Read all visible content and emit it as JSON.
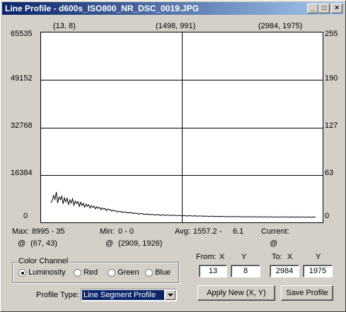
{
  "window": {
    "title": "Line Profile - d600s_ISO800_NR_DSC_0019.JPG",
    "buttons": [
      "_",
      "□",
      "×"
    ]
  },
  "chart": {
    "top_labels": [
      "(13, 8)",
      "(1498, 991)",
      "(2984, 1975)"
    ],
    "left_ticks": [
      "65535",
      "49152",
      "32768",
      "16384",
      "0"
    ],
    "right_ticks": [
      "255",
      "190",
      "127",
      "63",
      "0"
    ]
  },
  "chart_data": {
    "type": "line",
    "ylim": [
      0,
      65535
    ],
    "y_right_ticks": [
      255,
      190,
      127,
      63,
      0
    ],
    "grid": true,
    "series": [
      {
        "values": [
          5200,
          6100,
          7800,
          6400,
          8995,
          5100,
          7200,
          6300,
          7500,
          4800,
          6900,
          5500,
          6800,
          4500,
          6200,
          5100,
          6600,
          4300,
          5800,
          4900,
          5600,
          3900,
          5400,
          4200,
          5000,
          3600,
          4700,
          3900,
          4500,
          3300,
          4200,
          3500,
          4000,
          3000,
          3800,
          3200,
          3600,
          2700,
          3400,
          2900,
          3200,
          2400,
          3000,
          2600,
          2800,
          2200,
          2600,
          2300,
          2400,
          1900,
          2200,
          2000,
          2100,
          1700,
          2000,
          1800,
          1900,
          1500,
          1800,
          1600,
          1700,
          1300,
          1600,
          1400,
          1500,
          1100,
          1400,
          1300,
          1300,
          1000,
          1200,
          1100,
          1200,
          900,
          1100,
          1000,
          1050,
          800,
          1000,
          900,
          950,
          700,
          900,
          850,
          900,
          650,
          850,
          800,
          800,
          600,
          800,
          750,
          750,
          550,
          700,
          700,
          700,
          500,
          650,
          650,
          600,
          450,
          650,
          600,
          550,
          450,
          600,
          550,
          500,
          400,
          550,
          500,
          500,
          350,
          500,
          450,
          450,
          300,
          450,
          420,
          400,
          300,
          420,
          380,
          380,
          250,
          380,
          350,
          350,
          220,
          350,
          330,
          300,
          200,
          330,
          300,
          300,
          180,
          300,
          280,
          260,
          150,
          280,
          260,
          250,
          150,
          270,
          240,
          230,
          120,
          250,
          230,
          220,
          100,
          240,
          220,
          200,
          90,
          230,
          210,
          190,
          80,
          220,
          200,
          180,
          70,
          210,
          190,
          170,
          60,
          200,
          180,
          160,
          50,
          190,
          170,
          150,
          40,
          180,
          160,
          140,
          30,
          170,
          150,
          130,
          20,
          160,
          140,
          120,
          10,
          150,
          130,
          110,
          0,
          140,
          120,
          100
        ]
      }
    ]
  },
  "stats": {
    "max_label": "Max:",
    "max_value": "8995 - 35",
    "max_at_sym": "@",
    "max_at": "(67, 43)",
    "min_label": "Min:",
    "min_value": "0 - 0",
    "min_at_sym": "@",
    "min_at": "(2909, 1926)",
    "avg_label": "Avg:",
    "avg_value": "1557.2 -",
    "avg_value2": "6.1",
    "current_label": "Current:",
    "current_at_sym": "@"
  },
  "color_channel": {
    "legend": "Color Channel",
    "options": [
      "Luminosity",
      "Red",
      "Green",
      "Blue"
    ],
    "selected": "Luminosity"
  },
  "coords": {
    "from_label": "From:",
    "to_label": "To:",
    "x_label": "X",
    "y_label": "Y",
    "from_x": "13",
    "from_y": "8",
    "to_x": "2984",
    "to_y": "1975"
  },
  "profile": {
    "label": "Profile Type:",
    "selected": "Line Segment Profile"
  },
  "actions": {
    "apply": "Apply New (X, Y)",
    "save": "Save Profile"
  }
}
